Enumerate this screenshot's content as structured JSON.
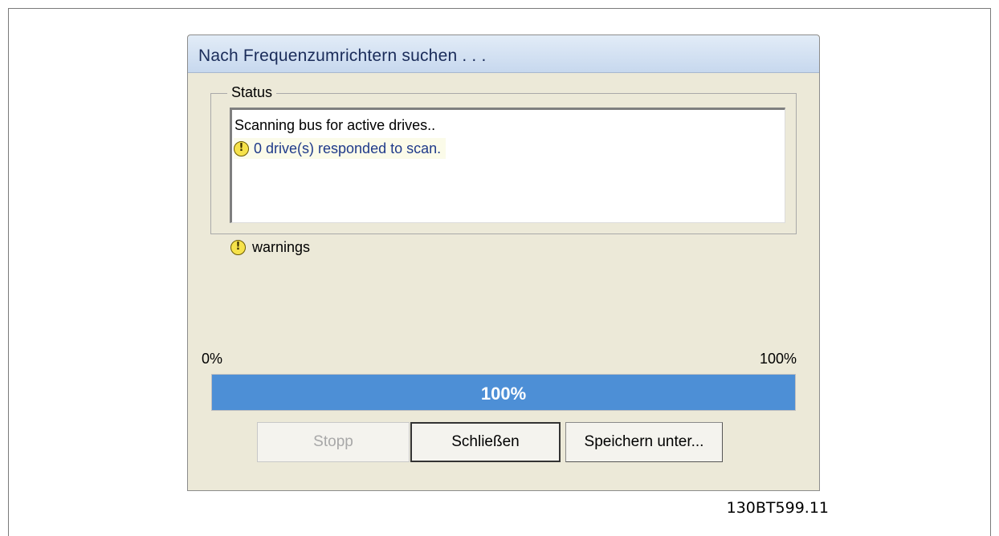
{
  "dialog": {
    "title": "Nach Frequenzumrichtern suchen . . ."
  },
  "status_group": {
    "label": "Status",
    "lines": [
      {
        "text": "Scanning bus for active drives..",
        "icon": null
      },
      {
        "text": "0 drive(s) responded to scan.",
        "icon": "warning-icon",
        "color": "#1f3a8a"
      }
    ]
  },
  "legend": {
    "icon": "warning-icon",
    "label": "warnings"
  },
  "progress": {
    "min_label": "0%",
    "max_label": "100%",
    "value_label": "100%",
    "value": 100,
    "fill_color": "#4d8fd6"
  },
  "buttons": {
    "stop": "Stopp",
    "close": "Schließen",
    "save_as": "Speichern unter..."
  },
  "figure_code": "130BT599.11"
}
